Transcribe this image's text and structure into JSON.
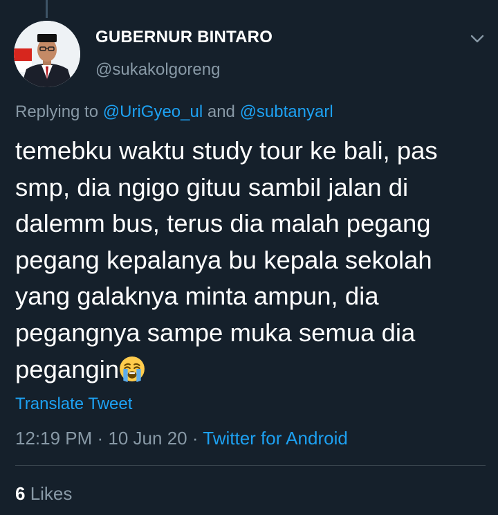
{
  "author": {
    "display_name": "GUBERNUR BINTARO",
    "handle": "@sukakolgoreng"
  },
  "reply": {
    "prefix": "Replying to ",
    "mention_1": "@UriGyeo_ul",
    "joiner": " and ",
    "mention_2": "@subtanyarl"
  },
  "tweet": {
    "lines": [
      "temebku waktu study tour ke bali, pas",
      "smp, dia ngigo gituu sambil jalan di",
      "dalemm bus, terus dia malah pegang",
      "pegang kepalanya bu kepala sekolah",
      "yang galaknya minta ampun, dia",
      "pegangnya sampe muka semua dia",
      "pegangin"
    ],
    "emoji": "loudly-crying-face"
  },
  "translate_label": "Translate Tweet",
  "meta": {
    "time": "12:19 PM",
    "sep1": " · ",
    "date": "10 Jun 20",
    "sep2": " · ",
    "source": "Twitter for Android"
  },
  "likes": {
    "count": "6",
    "label": " Likes"
  },
  "colors": {
    "background": "#15202b",
    "accent": "#1da1f2",
    "secondary_text": "#8899a6",
    "divider": "#38444d"
  }
}
